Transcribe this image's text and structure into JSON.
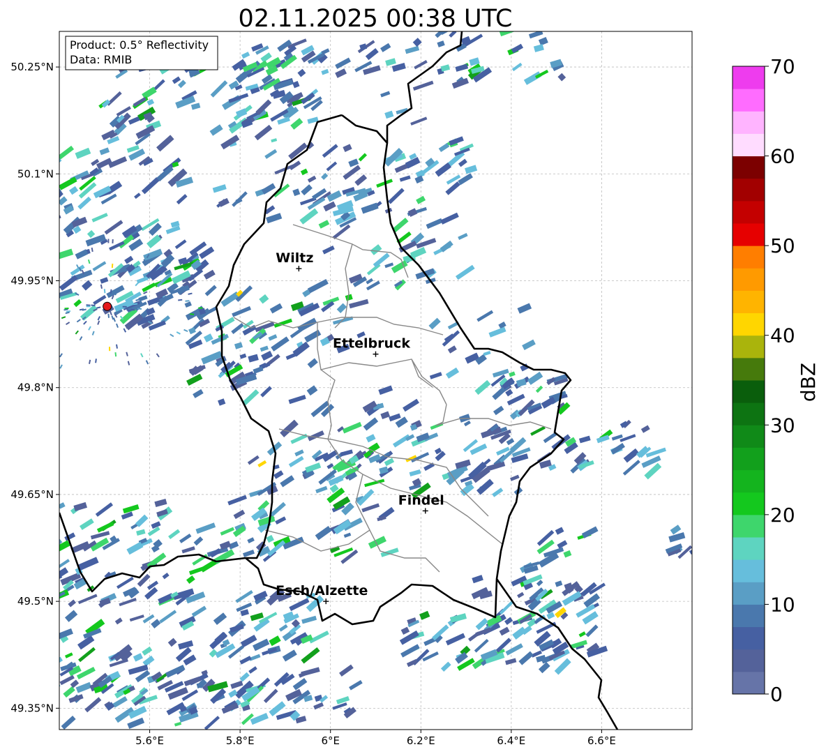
{
  "title": "02.11.2025 00:38 UTC",
  "info": {
    "product": "Product: 0.5° Reflectivity",
    "data": "Data: RMIB"
  },
  "map": {
    "lon_range": [
      5.4,
      6.8
    ],
    "lat_range": [
      49.32,
      50.3
    ],
    "grid": true,
    "lon_ticks": [
      {
        "value": 5.6,
        "label": "5.6°E"
      },
      {
        "value": 5.8,
        "label": "5.8°E"
      },
      {
        "value": 6.0,
        "label": "6°E"
      },
      {
        "value": 6.2,
        "label": "6.2°E"
      },
      {
        "value": 6.4,
        "label": "6.4°E"
      },
      {
        "value": 6.6,
        "label": "6.6°E"
      }
    ],
    "lat_ticks": [
      {
        "value": 50.25,
        "label": "50.25°N"
      },
      {
        "value": 50.1,
        "label": "50.1°N"
      },
      {
        "value": 49.95,
        "label": "49.95°N"
      },
      {
        "value": 49.8,
        "label": "49.8°N"
      },
      {
        "value": 49.65,
        "label": "49.65°N"
      },
      {
        "value": 49.5,
        "label": "49.5°N"
      },
      {
        "value": 49.35,
        "label": "49.35°N"
      }
    ],
    "cities": [
      {
        "name": "Wiltz",
        "lon": 5.93,
        "lat": 49.967
      },
      {
        "name": "Ettelbruck",
        "lon": 6.1,
        "lat": 49.847
      },
      {
        "name": "Findel",
        "lon": 6.21,
        "lat": 49.627
      },
      {
        "name": "Esch/Alzette",
        "lon": 5.99,
        "lat": 49.5
      }
    ],
    "radar_site": {
      "lon": 5.506,
      "lat": 49.914,
      "color": "#e41a1c"
    }
  },
  "colorbar": {
    "label": "dBZ",
    "min": 0,
    "max": 70,
    "step": 2.5,
    "ticks": [
      {
        "value": 0,
        "label": "0"
      },
      {
        "value": 10,
        "label": "10"
      },
      {
        "value": 20,
        "label": "20"
      },
      {
        "value": 30,
        "label": "30"
      },
      {
        "value": 40,
        "label": "40"
      },
      {
        "value": 50,
        "label": "50"
      },
      {
        "value": 60,
        "label": "60"
      },
      {
        "value": 70,
        "label": "70"
      }
    ],
    "colors": [
      "#6674a8",
      "#54629a",
      "#4660a2",
      "#4a78ad",
      "#5a9ec5",
      "#66bedc",
      "#5ed4c0",
      "#3ed66c",
      "#14c81e",
      "#14b41e",
      "#12a01c",
      "#108a18",
      "#0d7412",
      "#0a5e0c",
      "#467a0c",
      "#aab40c",
      "#ffd600",
      "#ffb400",
      "#ff9a00",
      "#ff7e00",
      "#e60000",
      "#c40000",
      "#a20000",
      "#7c0000",
      "#ffdcff",
      "#ffb4ff",
      "#ff6cff",
      "#ee3cee"
    ]
  }
}
